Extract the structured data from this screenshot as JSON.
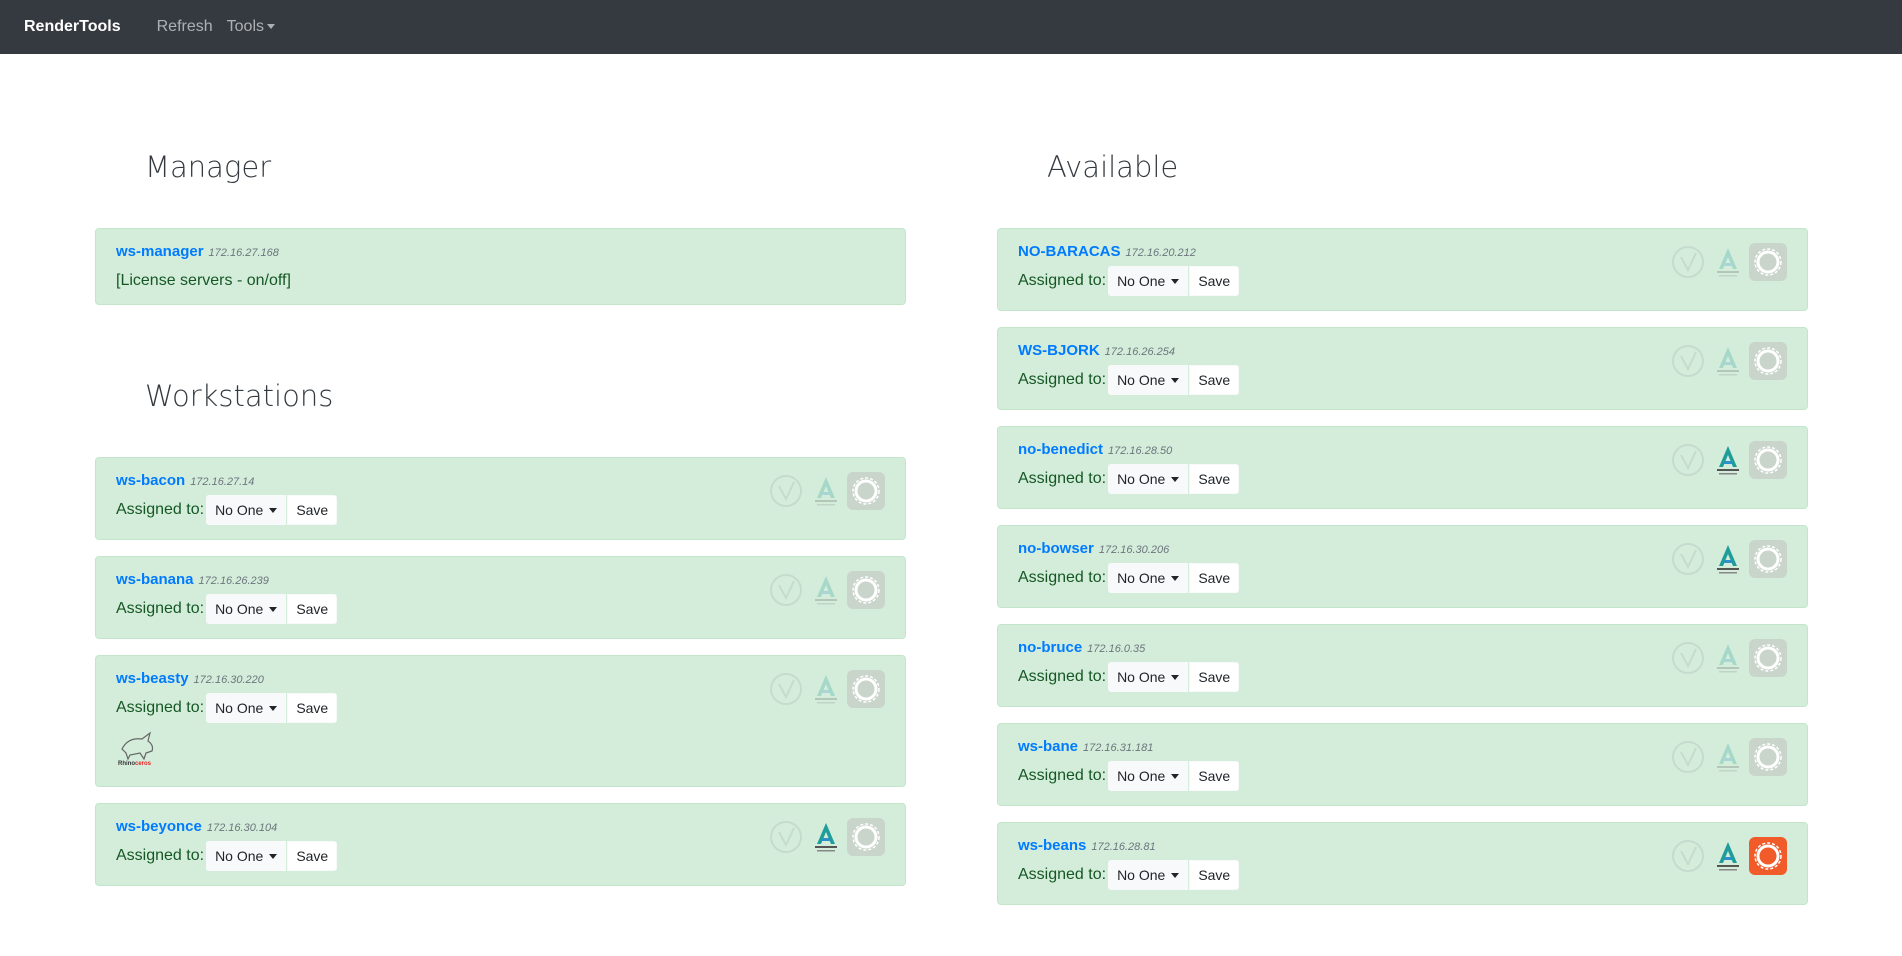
{
  "nav": {
    "brand": "RenderTools",
    "refresh": "Refresh",
    "tools": "Tools"
  },
  "manager": {
    "title": "Manager",
    "host": "ws-manager",
    "ip": "172.16.27.168",
    "note": "[License servers - on/off]"
  },
  "workstations": {
    "title": "Workstations",
    "items": [
      {
        "host": "ws-bacon",
        "ip": "172.16.27.14",
        "assigned_label": "Assigned to:",
        "assigned_value": "No One",
        "save": "Save",
        "autodesk_active": false,
        "corona_active": false
      },
      {
        "host": "ws-banana",
        "ip": "172.16.26.239",
        "assigned_label": "Assigned to:",
        "assigned_value": "No One",
        "save": "Save",
        "autodesk_active": false,
        "corona_active": false
      },
      {
        "host": "ws-beasty",
        "ip": "172.16.30.220",
        "assigned_label": "Assigned to:",
        "assigned_value": "No One",
        "save": "Save",
        "autodesk_active": false,
        "corona_active": false,
        "rhino": "Rhinoceros"
      },
      {
        "host": "ws-beyonce",
        "ip": "172.16.30.104",
        "assigned_label": "Assigned to:",
        "assigned_value": "No One",
        "save": "Save",
        "autodesk_active": true,
        "corona_active": false
      }
    ]
  },
  "available": {
    "title": "Available",
    "items": [
      {
        "host": "NO-BARACAS",
        "ip": "172.16.20.212",
        "assigned_label": "Assigned to:",
        "assigned_value": "No One",
        "save": "Save",
        "autodesk_active": false,
        "corona_active": false
      },
      {
        "host": "WS-BJORK",
        "ip": "172.16.26.254",
        "assigned_label": "Assigned to:",
        "assigned_value": "No One",
        "save": "Save",
        "autodesk_active": false,
        "corona_active": false
      },
      {
        "host": "no-benedict",
        "ip": "172.16.28.50",
        "assigned_label": "Assigned to:",
        "assigned_value": "No One",
        "save": "Save",
        "autodesk_active": true,
        "corona_active": false
      },
      {
        "host": "no-bowser",
        "ip": "172.16.30.206",
        "assigned_label": "Assigned to:",
        "assigned_value": "No One",
        "save": "Save",
        "autodesk_active": true,
        "corona_active": false
      },
      {
        "host": "no-bruce",
        "ip": "172.16.0.35",
        "assigned_label": "Assigned to:",
        "assigned_value": "No One",
        "save": "Save",
        "autodesk_active": false,
        "corona_active": false
      },
      {
        "host": "ws-bane",
        "ip": "172.16.31.181",
        "assigned_label": "Assigned to:",
        "assigned_value": "No One",
        "save": "Save",
        "autodesk_active": false,
        "corona_active": false
      },
      {
        "host": "ws-beans",
        "ip": "172.16.28.81",
        "assigned_label": "Assigned to:",
        "assigned_value": "No One",
        "save": "Save",
        "autodesk_active": true,
        "corona_active": true
      }
    ]
  },
  "colors": {
    "navbar": "#343a40",
    "card_bg": "#d4edda",
    "link": "#007bff",
    "corona": "#f15a29"
  },
  "icons": [
    "vray-icon",
    "autodesk-backburner-icon",
    "corona-icon",
    "rhinoceros-logo"
  ]
}
